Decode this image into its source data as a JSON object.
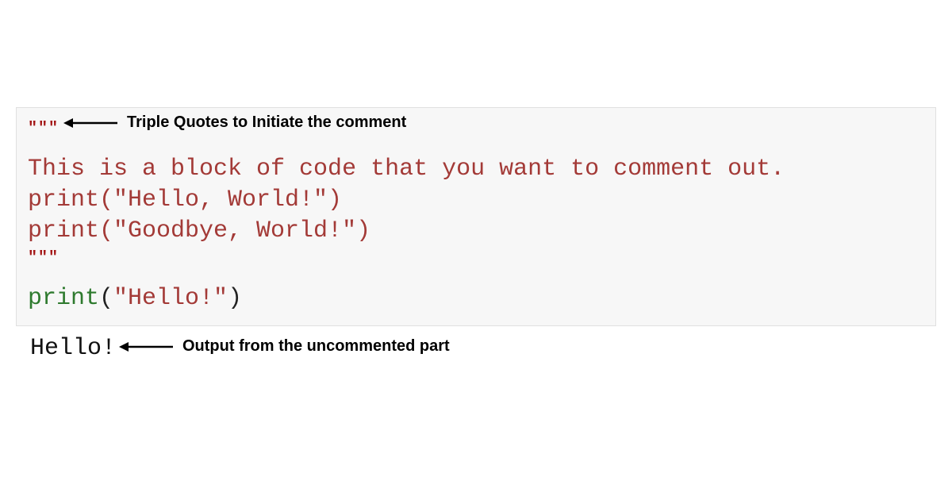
{
  "code": {
    "triple_open": "\"\"\"",
    "line1": "This is a block of code that you want to comment out.",
    "line2": "print(\"Hello, World!\")",
    "line3": "print(\"Goodbye, World!\")",
    "triple_close": "\"\"\"",
    "active_fn": "print",
    "active_paren_open": "(",
    "active_str": "\"Hello!\"",
    "active_paren_close": ")"
  },
  "output": {
    "text": "Hello!"
  },
  "annotations": {
    "top": "Triple Quotes to Initiate the comment",
    "bottom": "Output from the uncommented part"
  }
}
